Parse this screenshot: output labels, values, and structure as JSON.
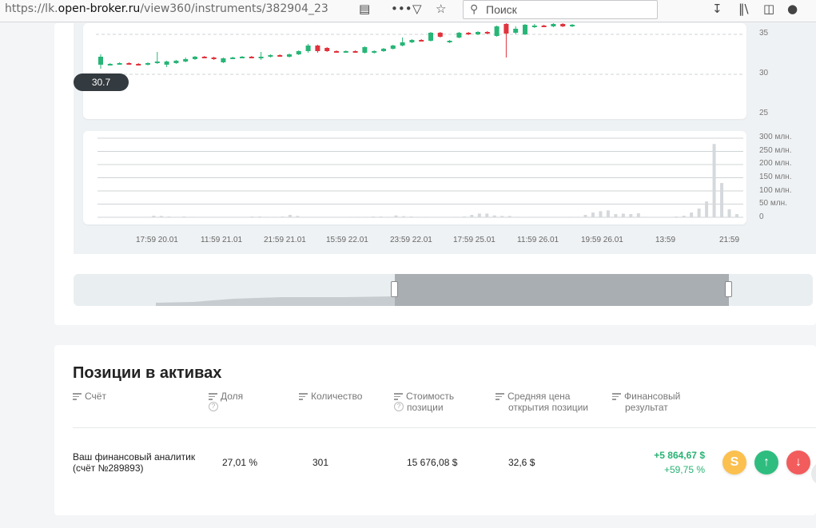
{
  "browser": {
    "url_prefix": "https://lk.",
    "url_host": "open-broker.ru",
    "url_path": "/view360/instruments/382904_23",
    "search_placeholder": "Поиск"
  },
  "chart": {
    "current_price": "30.7",
    "price_axis": [
      "35",
      "30",
      "25"
    ],
    "volume_axis": [
      "300 млн.",
      "250 млн.",
      "200 млн.",
      "150 млн.",
      "100 млн.",
      "50 млн.",
      "0"
    ],
    "time_axis": [
      "17:59 20.01",
      "11:59 21.01",
      "21:59 21.01",
      "15:59 22.01",
      "23:59 22.01",
      "17:59 25.01",
      "11:59 26.01",
      "19:59 26.01",
      "13:59",
      "21:59"
    ],
    "colors": {
      "up": "#28b577",
      "down": "#e0333c",
      "volume": "#d5d9dc"
    }
  },
  "chart_data": {
    "type": "candlestick",
    "y_axis_ticks": [
      25,
      30,
      35
    ],
    "volume_ticks": [
      0,
      50,
      100,
      150,
      200,
      250,
      300
    ],
    "volume_unit": "млн.",
    "x_tick_labels": [
      "17:59 20.01",
      "11:59 21.01",
      "21:59 21.01",
      "15:59 22.01",
      "23:59 22.01",
      "17:59 25.01",
      "11:59 26.01",
      "19:59 26.01",
      "13:59",
      "21:59"
    ],
    "last_price": 30.7,
    "candles": [
      {
        "o": 31.2,
        "c": 32.2,
        "h": 32.5,
        "l": 30.7
      },
      {
        "o": 31.2,
        "c": 31.3,
        "h": 31.4,
        "l": 31.1
      },
      {
        "o": 31.3,
        "c": 31.4,
        "h": 31.5,
        "l": 31.2
      },
      {
        "o": 31.4,
        "c": 31.3,
        "h": 31.5,
        "l": 31.2
      },
      {
        "o": 31.3,
        "c": 31.2,
        "h": 31.4,
        "l": 31.1
      },
      {
        "o": 31.2,
        "c": 31.4,
        "h": 31.5,
        "l": 31.1
      },
      {
        "o": 31.4,
        "c": 31.6,
        "h": 32.8,
        "l": 31.3
      },
      {
        "o": 31.2,
        "c": 31.6,
        "h": 31.7,
        "l": 30.9
      },
      {
        "o": 31.4,
        "c": 31.7,
        "h": 31.8,
        "l": 31.3
      },
      {
        "o": 31.6,
        "c": 31.9,
        "h": 32.1,
        "l": 31.5
      },
      {
        "o": 31.9,
        "c": 32.2,
        "h": 32.3,
        "l": 31.8
      },
      {
        "o": 32.2,
        "c": 32.1,
        "h": 32.3,
        "l": 32.0
      },
      {
        "o": 32.1,
        "c": 31.9,
        "h": 32.2,
        "l": 31.8
      },
      {
        "o": 31.5,
        "c": 32.0,
        "h": 32.1,
        "l": 31.4
      },
      {
        "o": 32.0,
        "c": 32.1,
        "h": 32.2,
        "l": 31.9
      },
      {
        "o": 32.1,
        "c": 32.2,
        "h": 32.3,
        "l": 32.0
      },
      {
        "o": 32.2,
        "c": 32.1,
        "h": 32.3,
        "l": 32.0
      },
      {
        "o": 32.1,
        "c": 32.2,
        "h": 32.8,
        "l": 31.8
      },
      {
        "o": 32.2,
        "c": 32.4,
        "h": 32.5,
        "l": 32.1
      },
      {
        "o": 32.4,
        "c": 32.3,
        "h": 32.5,
        "l": 32.2
      },
      {
        "o": 32.2,
        "c": 32.5,
        "h": 32.6,
        "l": 32.1
      },
      {
        "o": 32.5,
        "c": 32.9,
        "h": 33.0,
        "l": 32.4
      },
      {
        "o": 32.9,
        "c": 33.6,
        "h": 33.8,
        "l": 32.7
      },
      {
        "o": 33.6,
        "c": 32.9,
        "h": 33.7,
        "l": 32.7
      },
      {
        "o": 33.3,
        "c": 32.9,
        "h": 33.4,
        "l": 32.8
      },
      {
        "o": 32.9,
        "c": 32.8,
        "h": 33.0,
        "l": 32.7
      },
      {
        "o": 32.8,
        "c": 32.9,
        "h": 33.0,
        "l": 32.7
      },
      {
        "o": 32.9,
        "c": 32.8,
        "h": 33.0,
        "l": 32.7
      },
      {
        "o": 32.7,
        "c": 33.4,
        "h": 33.5,
        "l": 32.6
      },
      {
        "o": 32.7,
        "c": 32.9,
        "h": 33.0,
        "l": 32.6
      },
      {
        "o": 32.9,
        "c": 33.2,
        "h": 33.3,
        "l": 32.8
      },
      {
        "o": 33.2,
        "c": 33.6,
        "h": 33.7,
        "l": 33.1
      },
      {
        "o": 33.6,
        "c": 34.0,
        "h": 34.6,
        "l": 33.5
      },
      {
        "o": 34.0,
        "c": 34.3,
        "h": 34.4,
        "l": 33.9
      },
      {
        "o": 34.3,
        "c": 34.2,
        "h": 34.4,
        "l": 34.1
      },
      {
        "o": 34.2,
        "c": 35.2,
        "h": 35.3,
        "l": 34.1
      },
      {
        "o": 35.2,
        "c": 34.7,
        "h": 35.3,
        "l": 34.6
      },
      {
        "o": 34.0,
        "c": 34.2,
        "h": 34.3,
        "l": 33.9
      },
      {
        "o": 34.6,
        "c": 35.2,
        "h": 35.3,
        "l": 34.5
      },
      {
        "o": 35.2,
        "c": 35.0,
        "h": 35.3,
        "l": 34.9
      },
      {
        "o": 35.0,
        "c": 35.3,
        "h": 35.4,
        "l": 34.9
      },
      {
        "o": 35.3,
        "c": 35.1,
        "h": 35.4,
        "l": 35.0
      },
      {
        "o": 34.8,
        "c": 36.0,
        "h": 36.1,
        "l": 34.7
      },
      {
        "o": 36.3,
        "c": 35.1,
        "h": 36.4,
        "l": 32.1
      },
      {
        "o": 35.2,
        "c": 35.7,
        "h": 36.0,
        "l": 35.0
      },
      {
        "o": 35.0,
        "c": 36.2,
        "h": 36.3,
        "l": 34.9
      },
      {
        "o": 35.9,
        "c": 36.1,
        "h": 36.3,
        "l": 35.8
      },
      {
        "o": 36.1,
        "c": 36.0,
        "h": 36.2,
        "l": 35.9
      },
      {
        "o": 36.0,
        "c": 36.3,
        "h": 36.4,
        "l": 35.9
      },
      {
        "o": 36.3,
        "c": 36.0,
        "h": 36.4,
        "l": 35.9
      },
      {
        "o": 36.0,
        "c": 36.2,
        "h": 36.3,
        "l": 35.9
      }
    ],
    "volume": [
      0,
      0,
      0,
      0,
      0,
      0,
      0,
      6,
      5,
      3,
      2,
      3,
      2,
      0,
      0,
      0,
      0,
      0,
      0,
      0,
      3,
      3,
      2,
      2,
      3,
      9,
      5,
      0,
      0,
      0,
      0,
      0,
      0,
      2,
      2,
      2,
      3,
      3,
      2,
      7,
      4,
      3,
      2,
      2,
      0,
      0,
      0,
      2,
      3,
      9,
      14,
      14,
      7,
      5,
      5,
      2,
      1,
      0,
      0,
      0,
      0,
      0,
      2,
      2,
      9,
      18,
      23,
      26,
      12,
      14,
      12,
      15,
      2,
      1,
      1,
      1,
      3,
      6,
      18,
      33,
      60,
      278,
      130,
      30,
      12
    ]
  },
  "positions": {
    "title": "Позиции в активах",
    "columns": {
      "account": "Счёт",
      "share": "Доля",
      "quantity": "Количество",
      "value_l1": "Стоимость",
      "value_l2": "позиции",
      "avg_l1": "Средняя цена",
      "avg_l2": "открытия позиции",
      "result_l1": "Финансовый",
      "result_l2": "результат",
      "help": "?"
    },
    "row": {
      "account_l1": "Ваш финансовый аналитик",
      "account_l2": "(счёт №289893)",
      "share": "27,01 %",
      "quantity": "301",
      "value": "15 676,08 $",
      "avg_price": "32,6 $",
      "result_abs": "+5 864,67 $",
      "result_pct": "+59,75 %"
    },
    "actions": {
      "dividend": "S",
      "buy": "↑",
      "sell": "↓"
    },
    "colors": {
      "positive": "#27b373",
      "dividend": "#fbc04e",
      "buy": "#2fbd7f",
      "sell": "#f25c5c"
    }
  }
}
